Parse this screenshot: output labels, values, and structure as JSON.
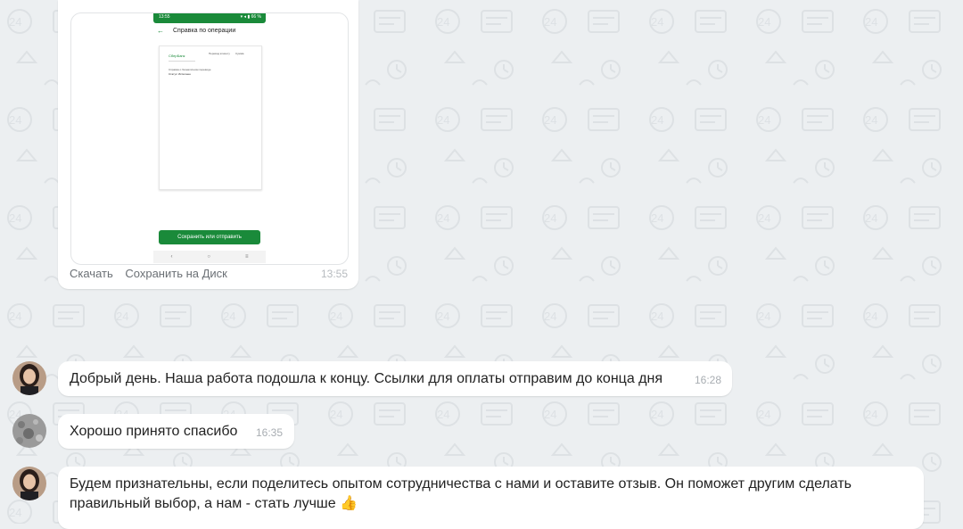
{
  "image_message": {
    "phone": {
      "status_time": "13:55",
      "status_icons": "▾ ◂ ▮ 66 %",
      "screen_title": "Справка по операции",
      "doc_heading": "СберБанк",
      "doc_line1": "Справка о безналичном переводе",
      "doc_line2": "Статус: Исполнен",
      "doc_line3": "Перевод клиенту",
      "doc_line4": "Сумма",
      "save_button": "Сохранить или отправить",
      "nav_back": "‹",
      "nav_home": "○",
      "nav_menu": "≡"
    },
    "action_download": "Скачать",
    "action_save_disk": "Сохранить на Диск",
    "time": "13:55"
  },
  "messages": [
    {
      "sender": "agent",
      "text": "Добрый день. Наша работа подошла к концу. Ссылки для оплаты отправим до конца дня",
      "time": "16:28"
    },
    {
      "sender": "user",
      "text": "Хорошо принято спасибо",
      "time": "16:35"
    },
    {
      "sender": "agent",
      "text": "Будем признательны, если поделитесь опытом сотрудничества с нами и оставите отзыв. Он поможет другим сделать правильный выбор, а нам - стать лучше 👍",
      "time": ""
    }
  ],
  "colors": {
    "background": "#eceff1",
    "bubble": "#ffffff",
    "sber_green": "#1a8a3a"
  }
}
